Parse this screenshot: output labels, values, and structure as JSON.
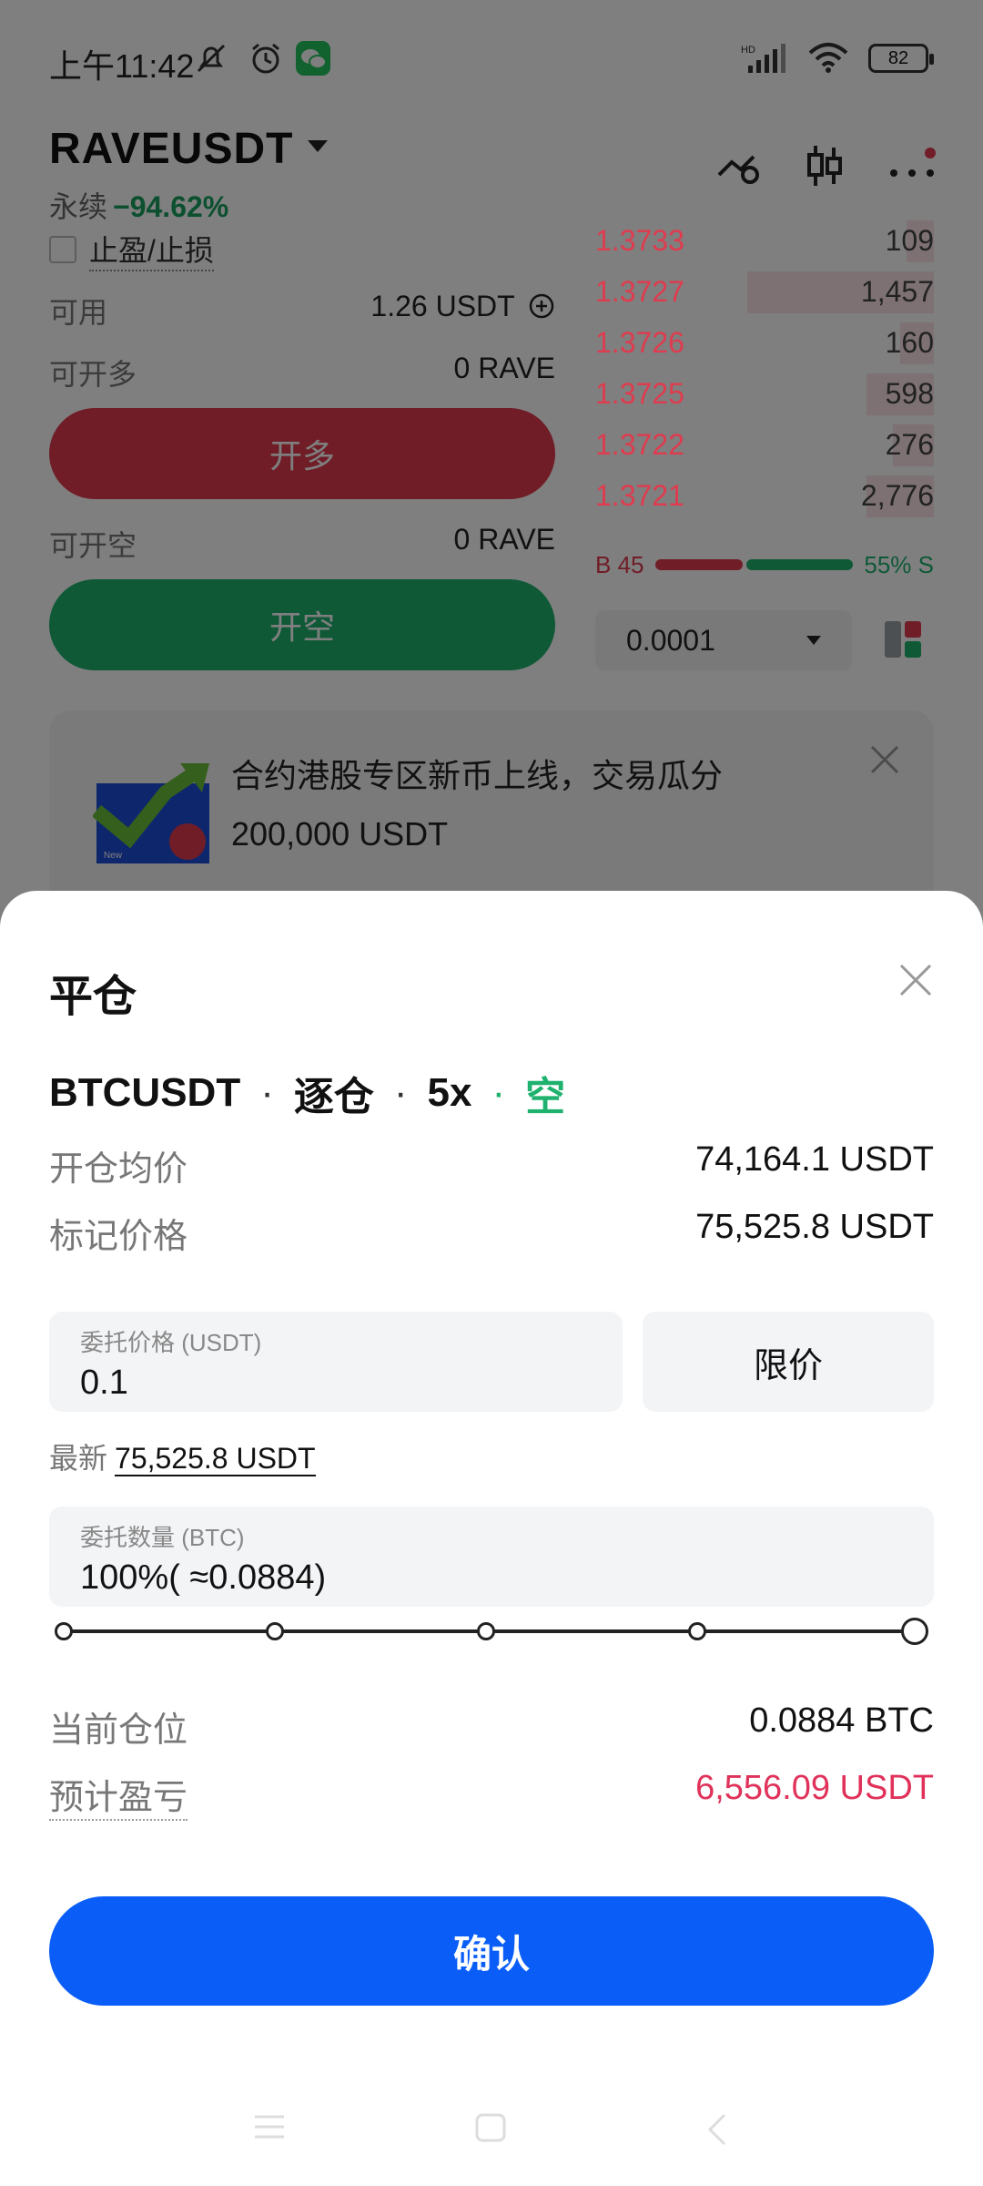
{
  "status_bar": {
    "time": "上午11:42",
    "battery": "82",
    "network": "HD"
  },
  "trade": {
    "pair": "RAVEUSDT",
    "perp_label": "永续",
    "change": "−94.62%",
    "tpsl_label": "止盈/止损",
    "available_label": "可用",
    "available_value": "1.26 USDT",
    "can_long_label": "可开多",
    "can_long_value": "0 RAVE",
    "long_button": "开多",
    "can_short_label": "可开空",
    "can_short_value": "0 RAVE",
    "short_button": "开空",
    "orderbook": [
      {
        "price": "1.3733",
        "qty": "109",
        "depth": 0.08
      },
      {
        "price": "1.3727",
        "qty": "1,457",
        "depth": 0.55
      },
      {
        "price": "1.3726",
        "qty": "160",
        "depth": 0.1
      },
      {
        "price": "1.3725",
        "qty": "598",
        "depth": 0.2
      },
      {
        "price": "1.3722",
        "qty": "276",
        "depth": 0.12
      },
      {
        "price": "1.3721",
        "qty": "2,776",
        "depth": 0.2
      }
    ],
    "buy_ratio_label": "B 45",
    "sell_ratio_label": "55% S",
    "buy_ratio": 0.45,
    "tick_size": "0.0001",
    "banner_line1": "合约港股专区新币上线，交易瓜分",
    "banner_line2": "200,000 USDT",
    "banner_badge": "New"
  },
  "sheet": {
    "title": "平仓",
    "symbol": "BTCUSDT",
    "margin_mode": "逐仓",
    "leverage": "5x",
    "direction": "空",
    "avg_open_label": "开仓均价",
    "avg_open_value": "74,164.1 USDT",
    "mark_price_label": "标记价格",
    "mark_price_value": "75,525.8 USDT",
    "order_price_label": "委托价格 (USDT)",
    "order_price_value": "0.1",
    "order_type": "限价",
    "latest_label": "最新",
    "latest_value": "75,525.8 USDT",
    "order_qty_label": "委托数量 (BTC)",
    "order_qty_value": "100%( ≈0.0884)",
    "slider_percent": 100,
    "position_label": "当前仓位",
    "position_value": "0.0884 BTC",
    "pnl_label": "预计盈亏",
    "pnl_value": "6,556.09 USDT",
    "confirm_button": "确认"
  },
  "colors": {
    "red": "#e03b4e",
    "green": "#1fb26f",
    "blue": "#0a5ef7",
    "pnl_red": "#e0325a"
  },
  "icons": {
    "status": [
      "muted-bell-icon",
      "alarm-icon",
      "wechat-icon",
      "signal-icon",
      "wifi-icon",
      "battery-icon"
    ],
    "top": [
      "calculator-icon",
      "candlestick-icon",
      "more-icon"
    ]
  }
}
